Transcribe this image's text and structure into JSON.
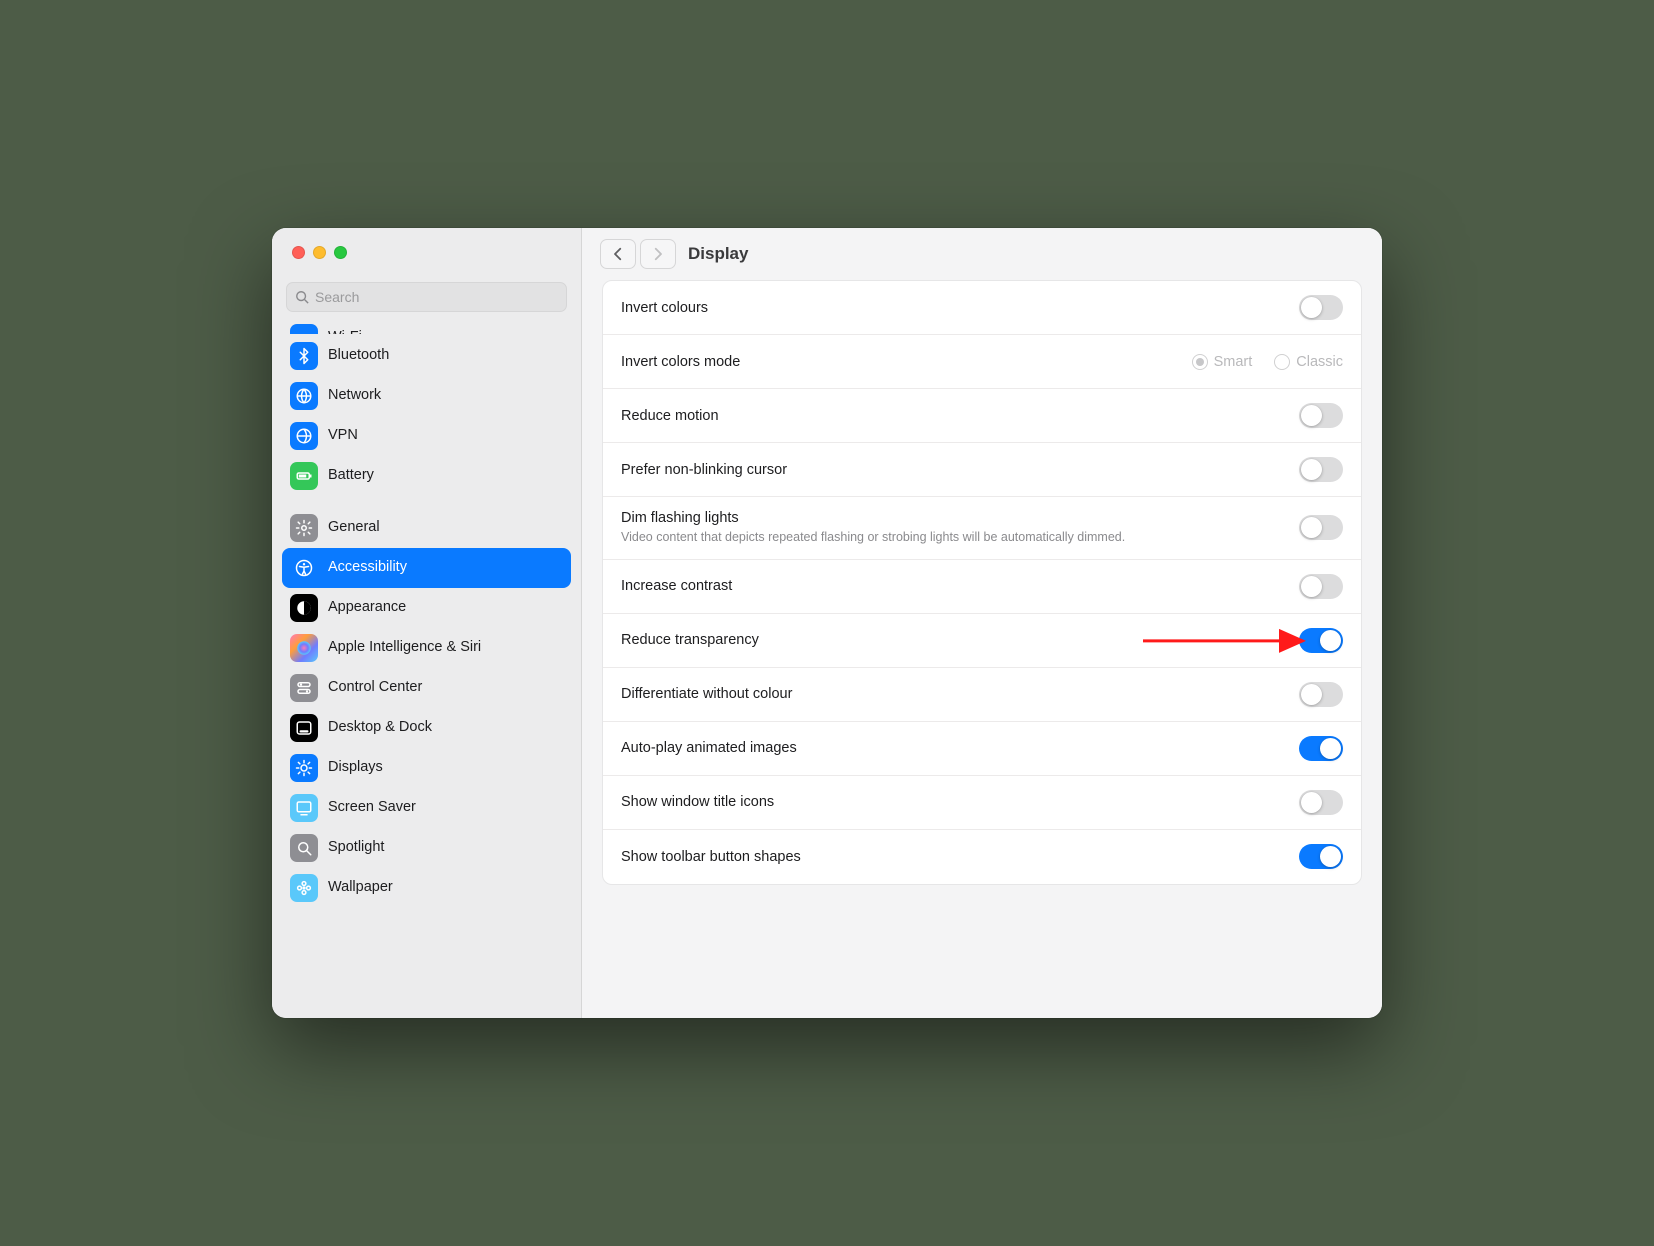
{
  "header": {
    "title": "Display",
    "search_placeholder": "Search"
  },
  "sidebar": {
    "items": [
      {
        "id": "wifi",
        "label": "Wi-Fi",
        "icon": "wifi",
        "color": "#0a7aff",
        "partial": true
      },
      {
        "id": "bluetooth",
        "label": "Bluetooth",
        "icon": "bluetooth",
        "color": "#0a7aff"
      },
      {
        "id": "network",
        "label": "Network",
        "icon": "globe",
        "color": "#0a7aff"
      },
      {
        "id": "vpn",
        "label": "VPN",
        "icon": "vpn",
        "color": "#0a7aff"
      },
      {
        "id": "battery",
        "label": "Battery",
        "icon": "battery",
        "color": "#34c759"
      },
      {
        "sep": true
      },
      {
        "id": "general",
        "label": "General",
        "icon": "gear",
        "color": "#8e8e93"
      },
      {
        "id": "accessibility",
        "label": "Accessibility",
        "icon": "accessibility",
        "color": "#0a7aff",
        "selected": true
      },
      {
        "id": "appearance",
        "label": "Appearance",
        "icon": "appearance",
        "color": "#000000"
      },
      {
        "id": "ai-siri",
        "label": "Apple Intelligence & Siri",
        "icon": "siri",
        "color": "gradient"
      },
      {
        "id": "control-center",
        "label": "Control Center",
        "icon": "switches",
        "color": "#8e8e93"
      },
      {
        "id": "desktop-dock",
        "label": "Desktop & Dock",
        "icon": "dock",
        "color": "#000000"
      },
      {
        "id": "displays",
        "label": "Displays",
        "icon": "brightness",
        "color": "#0a7aff"
      },
      {
        "id": "screen-saver",
        "label": "Screen Saver",
        "icon": "screensaver",
        "color": "#5ac8fa"
      },
      {
        "id": "spotlight",
        "label": "Spotlight",
        "icon": "search",
        "color": "#8e8e93"
      },
      {
        "id": "wallpaper",
        "label": "Wallpaper",
        "icon": "flower",
        "color": "#5ac8fa"
      }
    ]
  },
  "settings": {
    "rows": [
      {
        "id": "invert-colours",
        "label": "Invert colours",
        "control": "toggle",
        "value": false
      },
      {
        "id": "invert-colors-mode",
        "label": "Invert colors mode",
        "control": "radio",
        "options": [
          "Smart",
          "Classic"
        ],
        "value": "Smart",
        "disabled": true
      },
      {
        "id": "reduce-motion",
        "label": "Reduce motion",
        "control": "toggle",
        "value": false
      },
      {
        "id": "prefer-non-blinking-cursor",
        "label": "Prefer non-blinking cursor",
        "control": "toggle",
        "value": false
      },
      {
        "id": "dim-flashing-lights",
        "label": "Dim flashing lights",
        "desc": "Video content that depicts repeated flashing or strobing lights will be automatically dimmed.",
        "control": "toggle",
        "value": false
      },
      {
        "id": "increase-contrast",
        "label": "Increase contrast",
        "control": "toggle",
        "value": false
      },
      {
        "id": "reduce-transparency",
        "label": "Reduce transparency",
        "control": "toggle",
        "value": true,
        "highlight_arrow": true
      },
      {
        "id": "differentiate-without-colour",
        "label": "Differentiate without colour",
        "control": "toggle",
        "value": false
      },
      {
        "id": "auto-play-animated-images",
        "label": "Auto-play animated images",
        "control": "toggle",
        "value": true
      },
      {
        "id": "show-window-title-icons",
        "label": "Show window title icons",
        "control": "toggle",
        "value": false
      },
      {
        "id": "show-toolbar-button-shapes",
        "label": "Show toolbar button shapes",
        "control": "toggle",
        "value": true
      }
    ]
  }
}
